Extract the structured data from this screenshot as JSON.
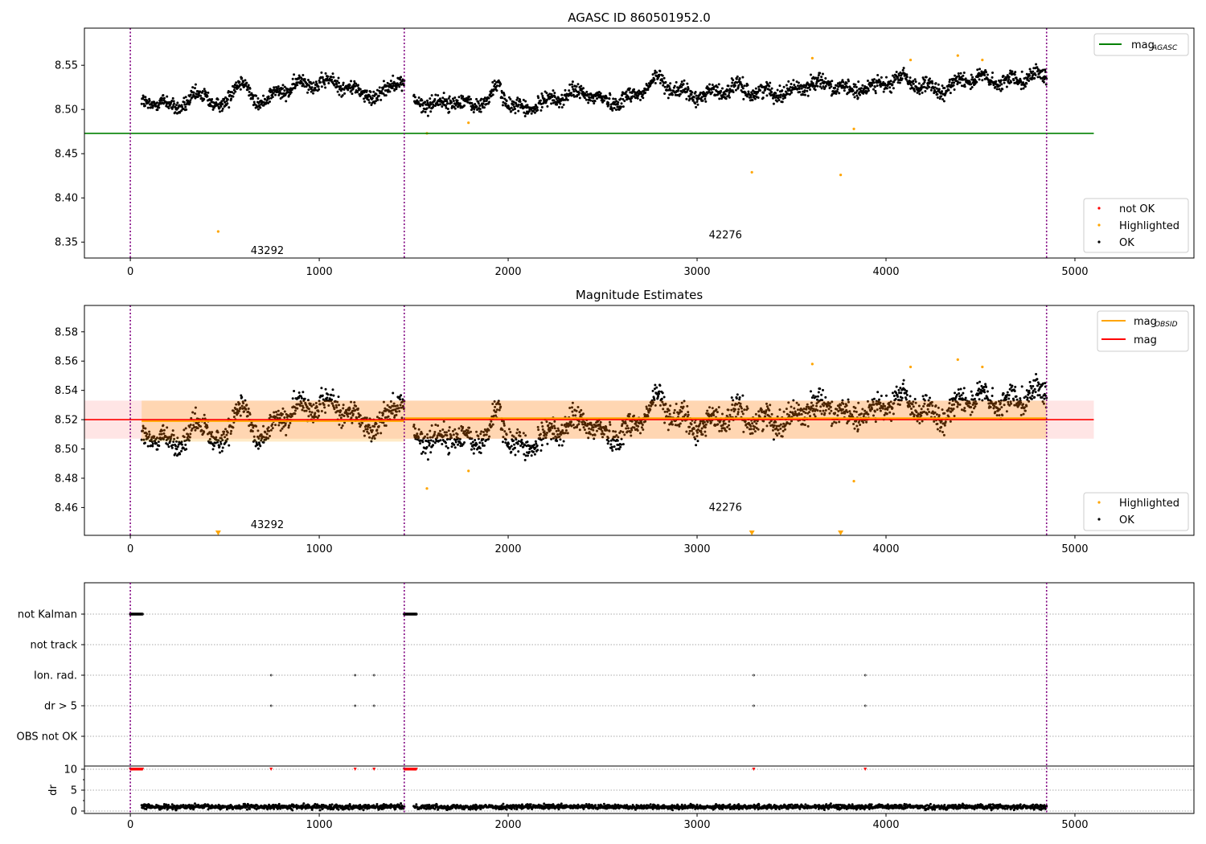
{
  "chart_data": [
    {
      "type": "scatter",
      "title": "AGASC ID 860501952.0",
      "xlim": [
        -243,
        5630
      ],
      "ylim": [
        8.332,
        8.592
      ],
      "xticks": [
        0,
        1000,
        2000,
        3000,
        4000,
        5000
      ],
      "yticks": [
        8.35,
        8.4,
        8.45,
        8.5,
        8.55
      ],
      "mag_agasc": 8.473,
      "mag_agasc_xrange": [
        -243,
        5100
      ],
      "legend_top": {
        "label": "mag",
        "sub": "AGASC",
        "color": "#008000"
      },
      "legend_bottom": [
        {
          "label": "not OK",
          "color": "#ff0000"
        },
        {
          "label": "Highlighted",
          "color": "#ffa500"
        },
        {
          "label": "OK",
          "color": "#000000"
        }
      ],
      "annotations": [
        {
          "text": "43292",
          "x": 725,
          "y": 8.34
        },
        {
          "text": "42276",
          "x": 3150,
          "y": 8.358
        }
      ],
      "obsid_boundaries": [
        0,
        1450,
        4850
      ]
    },
    {
      "type": "scatter",
      "title": "Magnitude Estimates",
      "xlim": [
        -243,
        5630
      ],
      "ylim": [
        8.441,
        8.598
      ],
      "xticks": [
        0,
        1000,
        2000,
        3000,
        4000,
        5000
      ],
      "yticks": [
        8.46,
        8.48,
        8.5,
        8.52,
        8.54,
        8.56,
        8.58
      ],
      "mag": 8.52,
      "mag_band": [
        8.507,
        8.533
      ],
      "mag_obsid": [
        {
          "x": [
            60,
            1450
          ],
          "value": 8.519,
          "band": [
            8.505,
            8.533
          ]
        },
        {
          "x": [
            1450,
            4850
          ],
          "value": 8.521,
          "band": [
            8.507,
            8.533
          ]
        }
      ],
      "legend_top": [
        {
          "label": "mag",
          "sub": "OBSID",
          "color": "#ffa500"
        },
        {
          "label": "mag",
          "sub": "",
          "color": "#ff0000"
        }
      ],
      "legend_bottom": [
        {
          "label": "Highlighted",
          "color": "#ffa500"
        },
        {
          "label": "OK",
          "color": "#000000"
        }
      ],
      "annotations": [
        {
          "text": "43292",
          "x": 725,
          "y": 8.448
        },
        {
          "text": "42276",
          "x": 3150,
          "y": 8.46
        }
      ]
    },
    {
      "type": "scatter",
      "flags": [
        "not Kalman",
        "not track",
        "Ion. rad.",
        "dr > 5",
        "OBS not OK"
      ],
      "flag_points": {
        "not Kalman": [
          [
            0,
            65
          ],
          [
            1450,
            1515
          ]
        ],
        "Ion. rad.": [
          745,
          1190,
          1290,
          3300,
          3890
        ],
        "dr > 5": [
          745,
          1190,
          1290,
          3300,
          3890
        ]
      },
      "dr_ylabel": "dr",
      "dr_ylim": [
        -0.58,
        10.77
      ],
      "dr_yticks": [
        0,
        5,
        10
      ],
      "dr_clip": 10,
      "dr_high_x": [
        [
          0,
          65
        ],
        [
          745,
          745
        ],
        [
          1190,
          1190
        ],
        [
          1290,
          1290
        ],
        [
          1450,
          1515
        ],
        [
          3300,
          3300
        ],
        [
          3890,
          3890
        ]
      ],
      "xticks": [
        0,
        1000,
        2000,
        3000,
        4000,
        5000
      ]
    }
  ],
  "series": {
    "ok_trend_x": [
      60,
      200,
      300,
      350,
      400,
      450,
      500,
      550,
      600,
      650,
      700,
      800,
      900,
      1000,
      1100,
      1200,
      1300,
      1350,
      1400,
      1450,
      1500,
      1600,
      1700,
      1800,
      1900,
      1950,
      2000,
      2100,
      2200,
      2300,
      2400,
      2500,
      2600,
      2700,
      2800,
      2900,
      3000,
      3100,
      3200,
      3300,
      3400,
      3500,
      3600,
      3700,
      3800,
      3900,
      4000,
      4100,
      4200,
      4300,
      4400,
      4500,
      4600,
      4700,
      4800,
      4850
    ],
    "ok_trend_mag": [
      8.51,
      8.505,
      8.505,
      8.515,
      8.52,
      8.5,
      8.505,
      8.53,
      8.53,
      8.51,
      8.51,
      8.52,
      8.53,
      8.53,
      8.53,
      8.52,
      8.515,
      8.52,
      8.535,
      8.53,
      8.51,
      8.505,
      8.51,
      8.505,
      8.51,
      8.53,
      8.505,
      8.5,
      8.51,
      8.515,
      8.52,
      8.51,
      8.51,
      8.52,
      8.535,
      8.52,
      8.515,
      8.52,
      8.525,
      8.52,
      8.52,
      8.52,
      8.53,
      8.53,
      8.52,
      8.525,
      8.53,
      8.535,
      8.525,
      8.52,
      8.535,
      8.535,
      8.53,
      8.535,
      8.54,
      8.535
    ],
    "ok_scatter_std": 0.006,
    "gap": [
      1450,
      1500
    ],
    "highlighted": [
      [
        465,
        8.362
      ],
      [
        1570,
        8.473
      ],
      [
        1790,
        8.485
      ],
      [
        3290,
        8.429
      ],
      [
        3760,
        8.426
      ],
      [
        3830,
        8.478
      ],
      [
        3610,
        8.558
      ],
      [
        4130,
        8.556
      ],
      [
        4380,
        8.561
      ],
      [
        4510,
        8.556
      ]
    ],
    "dr_mean": 1.0,
    "dr_std": 0.4
  }
}
